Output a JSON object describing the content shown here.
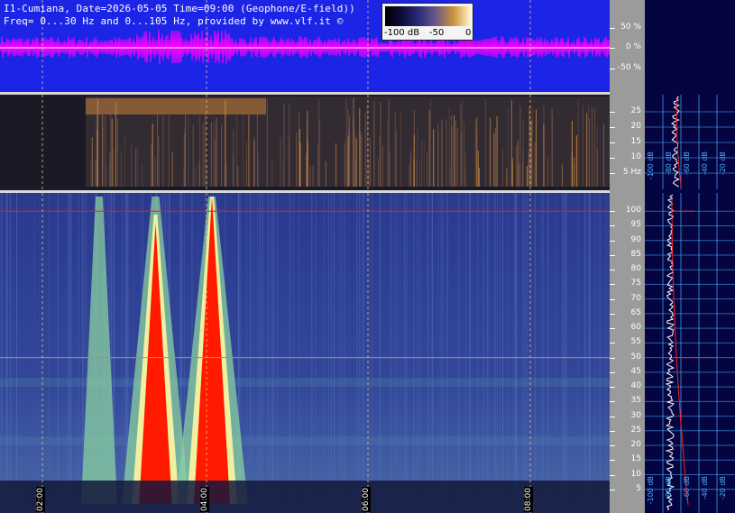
{
  "header": {
    "line1": "I1-Cumiana, Date=2026-05-05 Time=09:00 (Geophone/E-field))",
    "line2": "Freq= 0...30 Hz and 0...105 Hz, provided by www.vlf.it ©"
  },
  "colorbar": {
    "min_label": "-100 dB",
    "mid_label": "-50",
    "max_label": "0"
  },
  "colors": {
    "waveform_bg": "#1c24e6",
    "waveform_trace": "#ff00ff",
    "spectrum_hot": "#ff1a00",
    "scale_panel": "#9b9b9b",
    "profile_bg": "#040440",
    "profile_grid": "#4ab0ff",
    "profile_trace": "#ffffff",
    "profile_median": "#ff2020"
  },
  "chart_data": [
    {
      "type": "line",
      "panel": "waveform",
      "y_ticks": [
        "50 %",
        "0 %",
        "-50 %"
      ],
      "ylim": [
        -100,
        100
      ],
      "grid": true
    },
    {
      "type": "heatmap",
      "panel": "spectrogram-0-30Hz",
      "y_ticks": [
        "25",
        "20",
        "15",
        "10",
        "5 Hz"
      ],
      "ylim": [
        0,
        30
      ],
      "grid": true
    },
    {
      "type": "heatmap",
      "panel": "spectrogram-0-105Hz",
      "y_ticks": [
        "100",
        "95",
        "90",
        "85",
        "80",
        "75",
        "70",
        "65",
        "60",
        "55",
        "50",
        "45",
        "40",
        "35",
        "30",
        "25",
        "20",
        "15",
        "10",
        "5"
      ],
      "ylim": [
        0,
        105
      ],
      "x_ticks": [
        "02:00",
        "04:00",
        "06:00",
        "08:00"
      ],
      "grid": true
    },
    {
      "type": "line",
      "panel": "spectral-profile",
      "x_ticks": [
        "-100 dB",
        "-80 dB",
        "-60 dB",
        "-40 dB",
        "-20 dB"
      ],
      "x_ticks_upper": [
        "-100 dB",
        "-80 dB",
        "-60 dB",
        "-40 dB",
        "-20 dB"
      ]
    }
  ]
}
